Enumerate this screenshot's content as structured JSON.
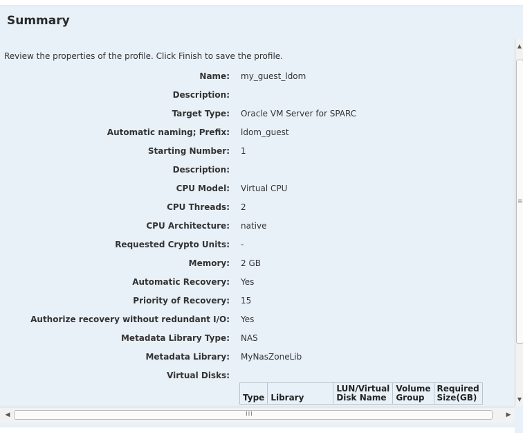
{
  "summary": {
    "title": "Summary",
    "intro": "Review the properties of the profile. Click Finish to save the profile.",
    "properties": [
      {
        "label": "Name:",
        "value": "my_guest_ldom"
      },
      {
        "label": "Description:",
        "value": ""
      },
      {
        "label": "Target Type:",
        "value": "Oracle VM Server for SPARC"
      },
      {
        "label": "Automatic naming; Prefix:",
        "value": "ldom_guest"
      },
      {
        "label": "Starting Number:",
        "value": "1"
      },
      {
        "label": "Description:",
        "value": ""
      },
      {
        "label": "CPU Model:",
        "value": "Virtual CPU"
      },
      {
        "label": "CPU Threads:",
        "value": "2"
      },
      {
        "label": "CPU Architecture:",
        "value": "native"
      },
      {
        "label": "Requested Crypto Units:",
        "value": "-"
      },
      {
        "label": "Memory:",
        "value": "2 GB"
      },
      {
        "label": "Automatic Recovery:",
        "value": "Yes"
      },
      {
        "label": "Priority of Recovery:",
        "value": "15"
      },
      {
        "label": "Authorize recovery without redundant I/O:",
        "value": "Yes"
      },
      {
        "label": "Metadata Library Type:",
        "value": "NAS"
      },
      {
        "label": "Metadata Library:",
        "value": "MyNasZoneLib"
      },
      {
        "label": "Virtual Disks:",
        "value": ""
      }
    ],
    "virtual_disks_table": {
      "columns": [
        "Type",
        "Library",
        "LUN/Virtual Disk Name",
        "Volume Group",
        "Required Size(GB)"
      ]
    }
  },
  "scrollbars": {
    "vertical_grip": "≡",
    "horizontal_grip": "III",
    "up_arrow": "▲",
    "down_arrow": "▼",
    "left_arrow": "◀",
    "right_arrow": "▶"
  }
}
